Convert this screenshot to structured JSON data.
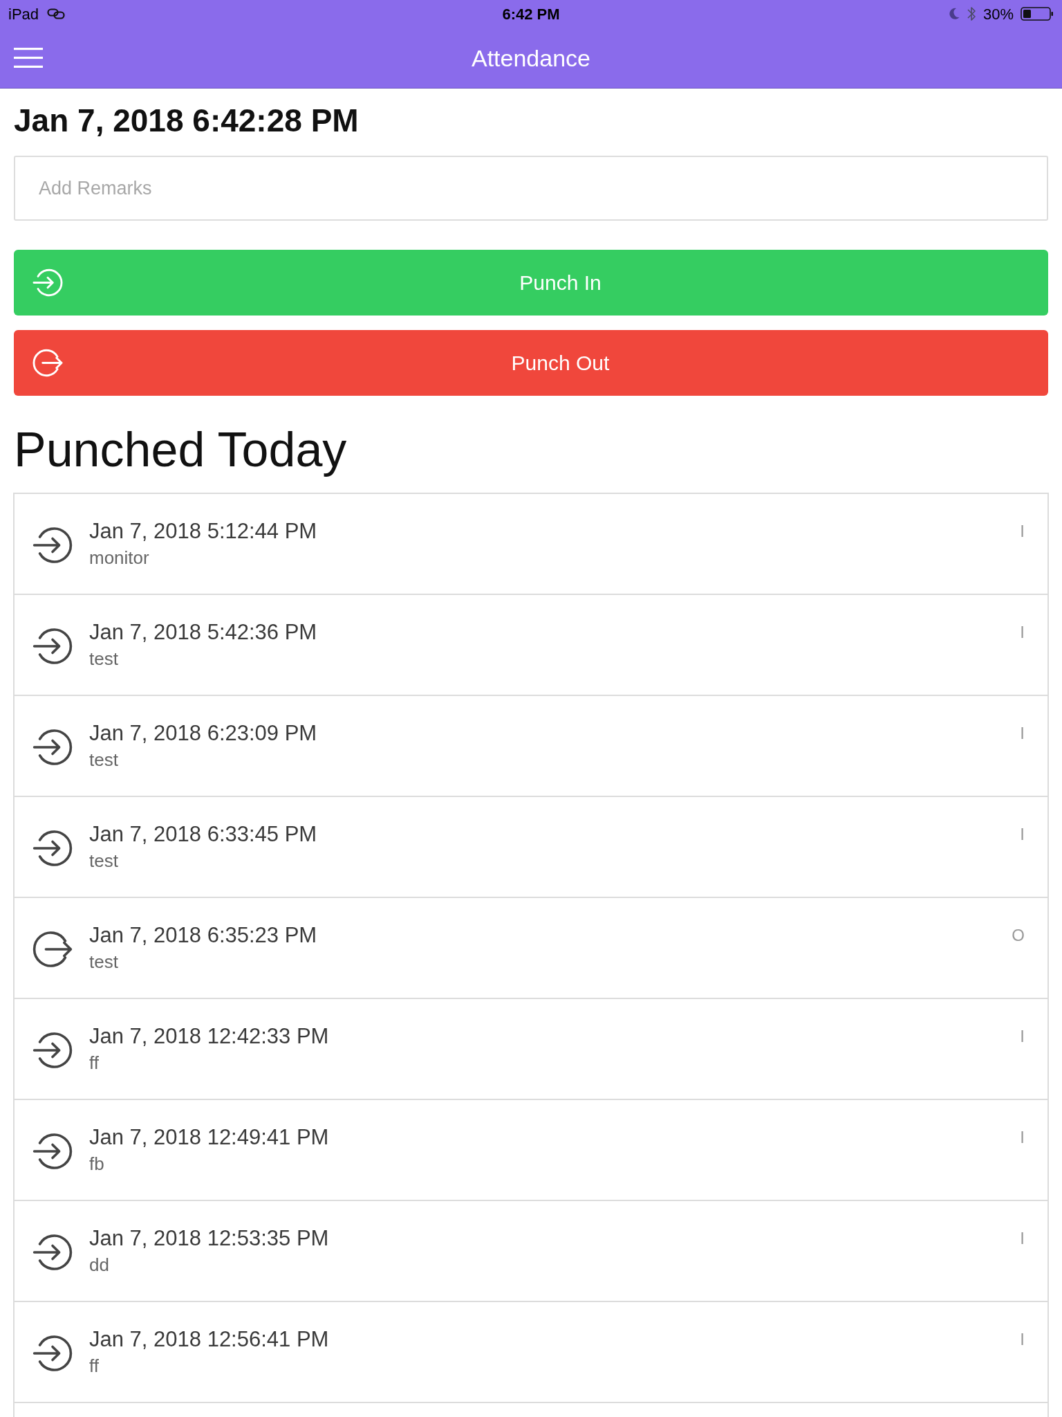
{
  "status_bar": {
    "device": "iPad",
    "time": "6:42 PM",
    "battery": "30%"
  },
  "nav_bar": {
    "title": "Attendance"
  },
  "current_time": "Jan 7, 2018 6:42:28 PM",
  "remarks_field": {
    "placeholder": "Add Remarks"
  },
  "actions": [
    {
      "kind": "in",
      "label": "Punch In"
    },
    {
      "kind": "out",
      "label": "Punch Out"
    }
  ],
  "section_title": "Punched Today",
  "punches": [
    {
      "kind": "in",
      "time": "Jan 7, 2018 5:12:44 PM",
      "remark": "monitor",
      "marker": "I"
    },
    {
      "kind": "in",
      "time": "Jan 7, 2018 5:42:36 PM",
      "remark": "test",
      "marker": "I"
    },
    {
      "kind": "in",
      "time": "Jan 7, 2018 6:23:09 PM",
      "remark": "test",
      "marker": "I"
    },
    {
      "kind": "in",
      "time": "Jan 7, 2018 6:33:45 PM",
      "remark": "test",
      "marker": "I"
    },
    {
      "kind": "out",
      "time": "Jan 7, 2018 6:35:23 PM",
      "remark": "test",
      "marker": "O"
    },
    {
      "kind": "in",
      "time": "Jan 7, 2018 12:42:33 PM",
      "remark": "ff",
      "marker": "I"
    },
    {
      "kind": "in",
      "time": "Jan 7, 2018 12:49:41 PM",
      "remark": "fb",
      "marker": "I"
    },
    {
      "kind": "in",
      "time": "Jan 7, 2018 12:53:35 PM",
      "remark": "dd",
      "marker": "I"
    },
    {
      "kind": "in",
      "time": "Jan 7, 2018 12:56:41 PM",
      "remark": "ff",
      "marker": "I"
    }
  ]
}
